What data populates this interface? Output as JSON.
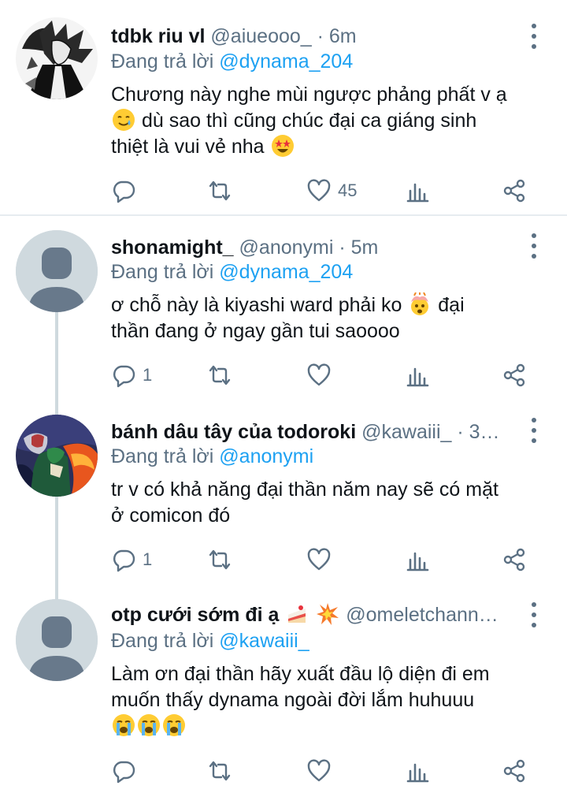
{
  "reply_prefix": "Đang trả lời",
  "tweets": [
    {
      "name": "tdbk riu vl",
      "handle": "@aiueooo_ · 6m",
      "reply_to": "@dynama_204",
      "lines": [
        "Chương này nghe mùi ngược phảng phất v ạ",
        "dù sao thì cũng chúc đại ca giáng sinh",
        "thiệt là vui vẻ nha"
      ],
      "emoji": [
        "smiling-face-with-tear",
        "star-struck"
      ],
      "reply_count": "",
      "like_count": "45"
    },
    {
      "name": "shonamight_",
      "handle": "@anonymi · 5m",
      "reply_to": "@dynama_204",
      "lines": [
        "ơ chỗ này là kiyashi ward phải ko",
        "đại",
        "thần đang ở ngay gần tui saoooo"
      ],
      "emoji": [
        "exploding-head"
      ],
      "reply_count": "1",
      "like_count": ""
    },
    {
      "name": "bánh dâu tây của todoroki",
      "handle": "@kawaiii_ · 3…",
      "reply_to": "@anonymi",
      "lines": [
        "tr v có khả năng đại thần năm nay sẽ có mặt",
        "ở comicon đó"
      ],
      "emoji": [],
      "reply_count": "1",
      "like_count": ""
    },
    {
      "name": "otp cưới sớm đi ạ",
      "handle": "@omeletchann…",
      "reply_to": "@kawaiii_",
      "lines": [
        "Làm ơn đại thần hãy xuất đầu lộ diện đi em",
        "muốn thấy dynama ngoài đời lắm huhuuu"
      ],
      "emoji": [
        "cake",
        "collision",
        "loudly-crying-face",
        "loudly-crying-face",
        "loudly-crying-face"
      ],
      "reply_count": "",
      "like_count": ""
    }
  ],
  "colors": {
    "secondary": "#5b7083",
    "link": "#1da1f2",
    "divider": "#e6ecf0",
    "avatar_default": "#cfd9de"
  }
}
